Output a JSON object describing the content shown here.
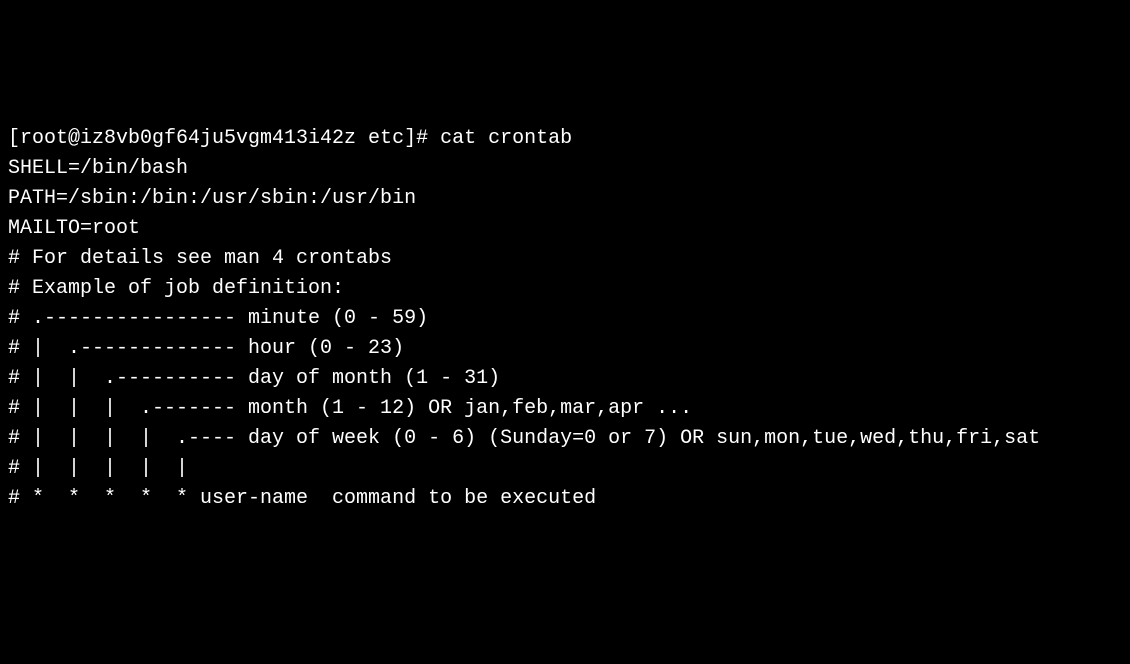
{
  "terminal": {
    "prompt": "[root@iz8vb0gf64ju5vgm413i42z etc]# ",
    "command": "cat crontab",
    "output": {
      "lines": [
        "SHELL=/bin/bash",
        "PATH=/sbin:/bin:/usr/sbin:/usr/bin",
        "MAILTO=root",
        "",
        "# For details see man 4 crontabs",
        "",
        "# Example of job definition:",
        "# .---------------- minute (0 - 59)",
        "# |  .------------- hour (0 - 23)",
        "# |  |  .---------- day of month (1 - 31)",
        "# |  |  |  .------- month (1 - 12) OR jan,feb,mar,apr ...",
        "# |  |  |  |  .---- day of week (0 - 6) (Sunday=0 or 7) OR sun,mon,tue,wed,thu,fri,sat",
        "# |  |  |  |  |",
        "# *  *  *  *  * user-name  command to be executed"
      ]
    }
  }
}
